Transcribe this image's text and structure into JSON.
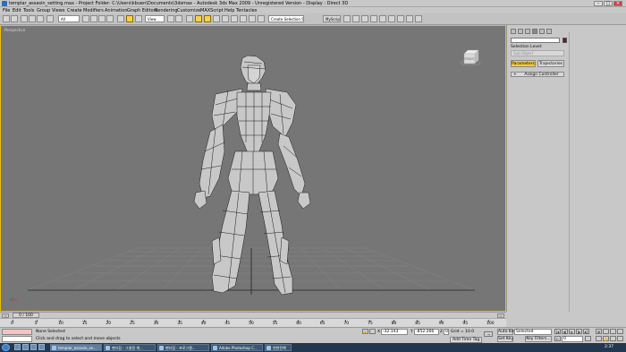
{
  "window": {
    "title": "templar_assasin_setting.max    -  Project Folder: C:\\Users\\kbuen\\Documents\\3dsmax    -  Autodesk 3ds Max  2009   - Unregistered Version    -  Display : Direct 3D"
  },
  "menu": [
    "File",
    "Edit",
    "Tools",
    "Group",
    "Views",
    "Create",
    "Modifiers",
    "Animation",
    "Graph Editors",
    "Rendering",
    "Customize",
    "MAXScript",
    "Help",
    "Tentacles"
  ],
  "toolbar": {
    "filter": "All",
    "ref_coord": "View",
    "named_selection": "Create Selection Set",
    "myscript": "MyScript"
  },
  "viewport": {
    "label": "Perspective",
    "viewcube_face": "FRONT"
  },
  "command_panel": {
    "selection_level": "Selection Level:",
    "sub_object": "Sub-Object",
    "tab_parameters": "Parameters",
    "tab_trajectories": "Trajectories",
    "rollout": "Assign Controller",
    "accent": "#f3c93b"
  },
  "timeline": {
    "frame": "0 / 100",
    "ticks": [
      "0",
      "5",
      "10",
      "15",
      "20",
      "25",
      "30",
      "35",
      "40",
      "45",
      "50",
      "55",
      "60",
      "65",
      "70",
      "75",
      "80",
      "85",
      "90",
      "95",
      "100"
    ]
  },
  "status": {
    "selection": "None Selected",
    "prompt": "Click and drag to select and move objects",
    "x_label": "X",
    "x_value": "-32.143",
    "y_label": "Y",
    "y_value": "-852.266",
    "z_label": "Z",
    "z_value": "0.0",
    "grid": "Grid = 10.0",
    "time_tag": "Add Time Tag",
    "auto_key": "Auto Key",
    "set_key": "Set Key",
    "key_mode": "Selected",
    "key_filters": "Key Filters...",
    "frame_field": "0"
  },
  "taskbar": {
    "tasks": [
      "templar_assasin_se...",
      "팬더잡 - 그설정 계...",
      "팬더잡 - 프로그램...",
      "Adobe Photoshop C...",
      "연한전책"
    ],
    "time": "2:37"
  }
}
